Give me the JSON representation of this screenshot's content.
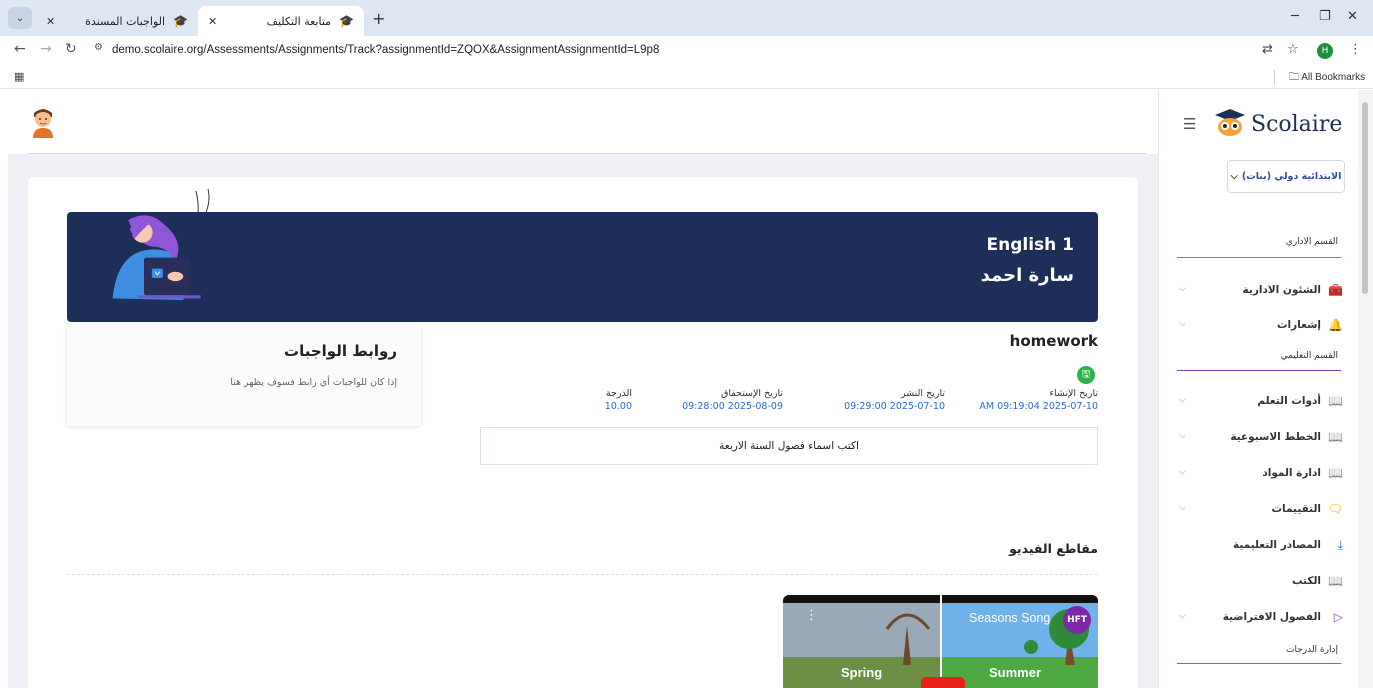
{
  "browser": {
    "tabs": [
      {
        "title": "الواجبات المسندة",
        "active": false
      },
      {
        "title": "متابعة التكليف",
        "active": true
      }
    ],
    "new_tab": "+",
    "url_host": "demo.scolaire.org",
    "url_path": "/Assessments/Assignments/Track?assignmentId=ZQOX&AssignmentAssignmentId=L9p8",
    "profile_initial": "H",
    "all_bookmarks": "All Bookmarks"
  },
  "banner": {
    "subject": "English 1",
    "student": "سارة احمد"
  },
  "assignment": {
    "title": "homework",
    "meta": [
      {
        "label": "تاريخ الإنشاء",
        "value": "AM 09:19:04 2025-07-10"
      },
      {
        "label": "تاريخ النشر",
        "value": "09:29:00 2025-07-10"
      },
      {
        "label": "تاريخ الإستحقاق",
        "value": "09:28:00 2025-08-09"
      },
      {
        "label": "الدرجة",
        "value": "10.00"
      }
    ],
    "description": "اكتب اسماء فصول السنة الاربعة"
  },
  "links": {
    "title": "روابط الواجبات",
    "empty_text": "إذا كان للواجبات أي رابط فسوف يظهر هنا"
  },
  "videos": {
    "title": "مقاطع الفيديو",
    "video_title": "Seasons Song",
    "logo": "HFT",
    "label_left": "Spring",
    "label_right": "Summer"
  },
  "sidebar": {
    "logo": "Scolaire",
    "school": "الابتدائية دولي (بنات)",
    "sections": [
      {
        "title": "القسم الاداري"
      },
      {
        "title": "القسم التعليمي"
      },
      {
        "title": "إدارة الدرجات"
      }
    ],
    "items": [
      {
        "label": "الشئون الادارية",
        "icon": "briefcase-icon",
        "chevron": true
      },
      {
        "label": "إشعارات",
        "icon": "bell-icon",
        "chevron": true
      },
      {
        "label": "أدوات التعلم",
        "icon": "book-icon",
        "chevron": true
      },
      {
        "label": "الخطط الاسبوعية",
        "icon": "book-icon",
        "chevron": true
      },
      {
        "label": "ادارة المواد",
        "icon": "book-icon",
        "chevron": true
      },
      {
        "label": "التقييمات",
        "icon": "message-icon",
        "chevron": true
      },
      {
        "label": "المصادر التعليمية",
        "icon": "download-icon",
        "chevron": false
      },
      {
        "label": "الكتب",
        "icon": "book-icon",
        "chevron": false
      },
      {
        "label": "الفصول الافتراضية",
        "icon": "play-icon",
        "chevron": true
      }
    ]
  },
  "colors": {
    "banner": "#1d2e59",
    "accent_blue": "#2b6bd1",
    "section_line_green": "#2db34a",
    "section_line_purple": "#8a3ab9",
    "section_line_pink": "#e0407a"
  }
}
